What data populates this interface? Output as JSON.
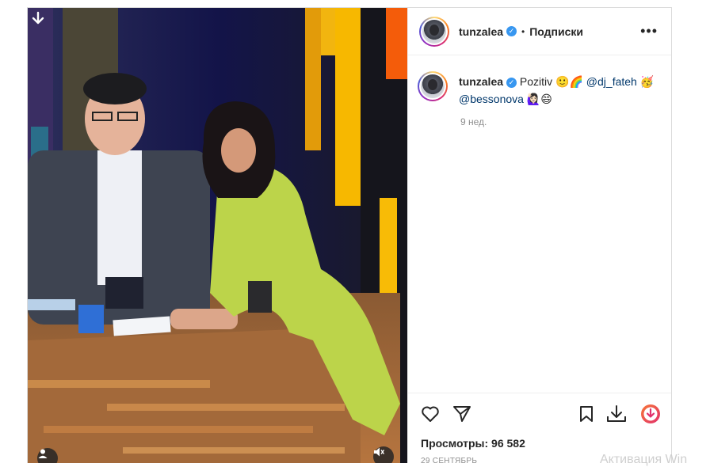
{
  "post": {
    "username": "tunzalea",
    "verified_mark": "✓",
    "separator": "•",
    "follow_label": "Подписки",
    "more_label": "•••",
    "caption_text": "Pozitiv 🙂🌈",
    "caption_mention_1": "@dj_fateh",
    "caption_emoji_1": "🥳",
    "caption_mention_2": "@bessonova",
    "caption_emoji_2": "🙋🏻‍♀️😄",
    "time_ago": "9 нед.",
    "views": "Просмотры: 96 582",
    "date": "29 СЕНТЯБРЬ"
  },
  "icons": {
    "like": "heart-icon",
    "share": "send-icon",
    "save": "bookmark-icon",
    "download": "download-icon",
    "extension": "extension-download-icon",
    "media_download": "down-arrow-icon",
    "user_tag": "user-icon",
    "mute": "speaker-muted-icon"
  },
  "colors": {
    "verified": "#3897f0",
    "mention": "#00376b",
    "extension_gradient": [
      "#f77737",
      "#e1306c"
    ],
    "meta_text": "#8e8e8e"
  },
  "system_watermark": "Активация Win"
}
